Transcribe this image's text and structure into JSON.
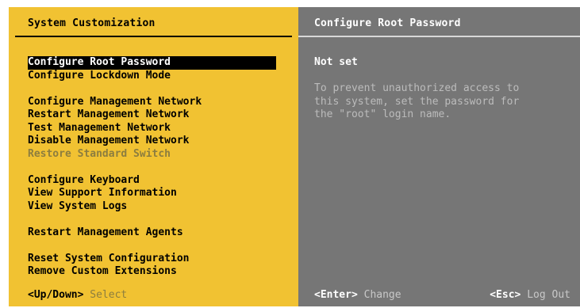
{
  "left_panel": {
    "title": "System Customization",
    "menu": [
      {
        "label": "Configure Root Password",
        "selected": true,
        "disabled": false
      },
      {
        "label": "Configure Lockdown Mode",
        "selected": false,
        "disabled": false
      },
      null,
      {
        "label": "Configure Management Network",
        "selected": false,
        "disabled": false
      },
      {
        "label": "Restart Management Network",
        "selected": false,
        "disabled": false
      },
      {
        "label": "Test Management Network",
        "selected": false,
        "disabled": false
      },
      {
        "label": "Disable Management Network",
        "selected": false,
        "disabled": false
      },
      {
        "label": "Restore Standard Switch",
        "selected": false,
        "disabled": true
      },
      null,
      {
        "label": "Configure Keyboard",
        "selected": false,
        "disabled": false
      },
      {
        "label": "View Support Information",
        "selected": false,
        "disabled": false
      },
      {
        "label": "View System Logs",
        "selected": false,
        "disabled": false
      },
      null,
      {
        "label": "Restart Management Agents",
        "selected": false,
        "disabled": false
      },
      null,
      {
        "label": "Reset System Configuration",
        "selected": false,
        "disabled": false
      },
      {
        "label": "Remove Custom Extensions",
        "selected": false,
        "disabled": false
      }
    ],
    "footer": {
      "key": "<Up/Down>",
      "action": "Select"
    }
  },
  "right_panel": {
    "title": "Configure Root Password",
    "status": "Not set",
    "description": "To prevent unauthorized access to\nthis system, set the password for\nthe \"root\" login name.",
    "footer": {
      "enter_key": "<Enter>",
      "enter_action": "Change",
      "esc_key": "<Esc>",
      "esc_action": "Log Out"
    }
  },
  "colors": {
    "left_bg": "#f1c232",
    "right_bg": "#767676",
    "selected_bg": "#000000",
    "disabled_text": "#8c7d3f"
  }
}
